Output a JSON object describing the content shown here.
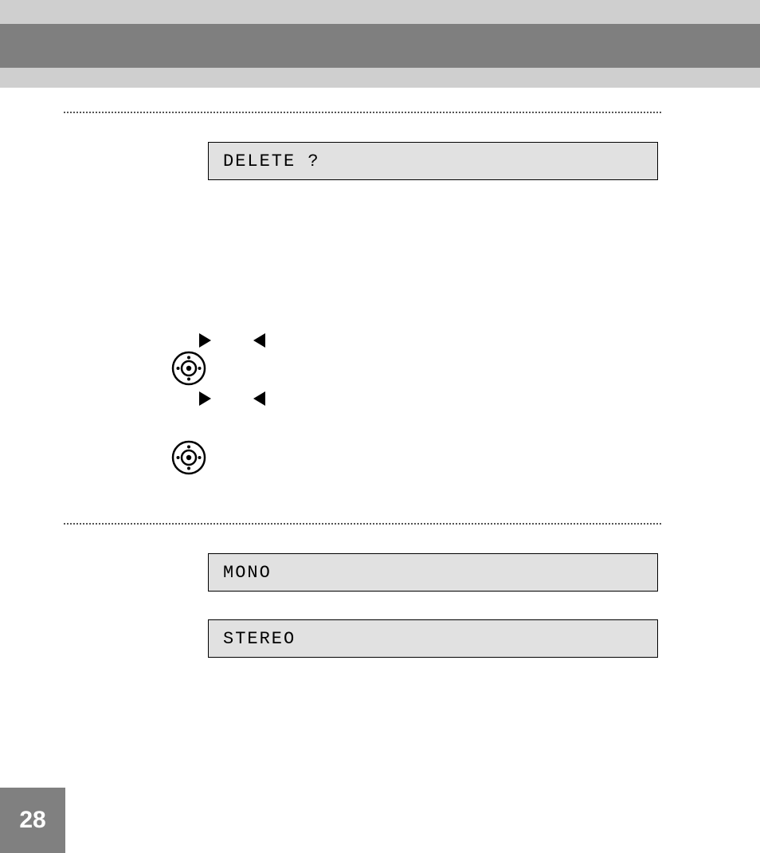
{
  "page_number": "28",
  "displays": {
    "delete": "DELETE ?",
    "mono": "MONO",
    "stereo": "STEREO"
  }
}
